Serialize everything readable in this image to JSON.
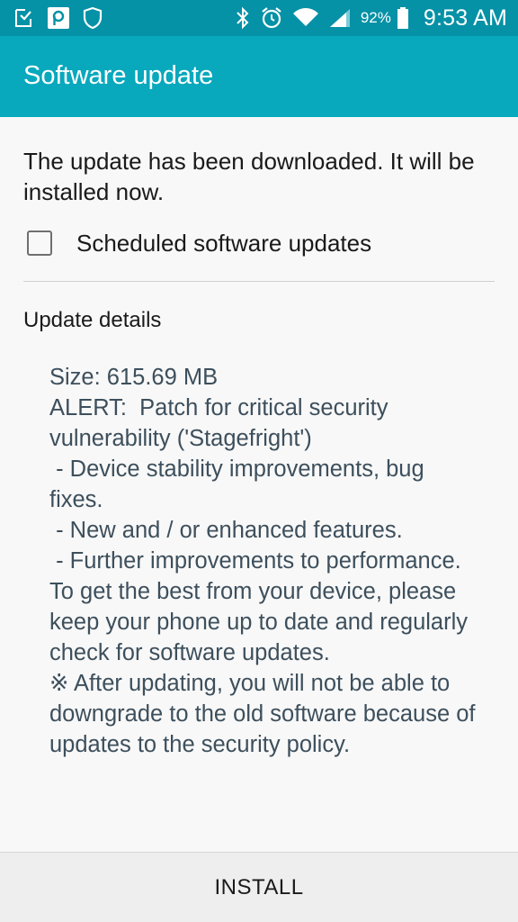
{
  "status_bar": {
    "icons_left": [
      "download-complete-icon",
      "pen-app-icon",
      "shield-icon"
    ],
    "icons_right": [
      "bluetooth-icon",
      "alarm-icon",
      "wifi-icon",
      "signal-icon"
    ],
    "battery_percent": "92%",
    "time": "9:53 AM",
    "background": "#0591a6"
  },
  "app_bar": {
    "title": "Software update",
    "background": "#08a8bd"
  },
  "main": {
    "message": "The update has been downloaded. It will be installed now.",
    "schedule_checkbox": {
      "label": "Scheduled software updates",
      "checked": false
    },
    "details_title": "Update details",
    "details_lines": [
      "Size: 615.69 MB",
      "ALERT:  Patch for critical security vulnerability ('Stagefright')",
      " - Device stability improvements, bug fixes.",
      " - New and / or enhanced features.",
      " - Further improvements to performance.",
      "To get the best from your device, please keep your phone up to date and regularly check for software updates.",
      "※ After updating, you will not be able to downgrade to the old software because of updates to the security policy."
    ]
  },
  "footer": {
    "install_label": "INSTALL"
  }
}
